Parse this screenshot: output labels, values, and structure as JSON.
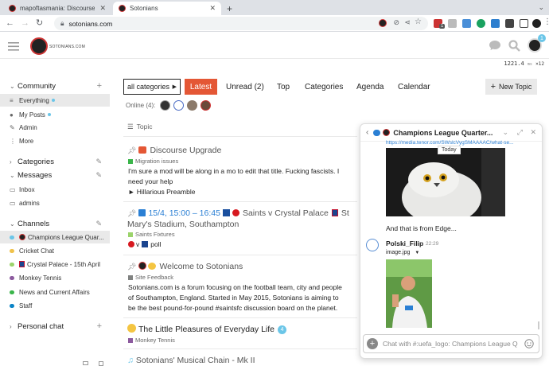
{
  "browser": {
    "tabs": [
      {
        "title": "mapoftasmania: Discourse Upgrade",
        "active": false
      },
      {
        "title": "Sotonians",
        "active": true
      }
    ],
    "new_tab": "+",
    "url": "sotonians.com",
    "ext_badge": "1"
  },
  "site": {
    "logo_text": "SOTONIANS.COM",
    "notif_count": "1",
    "counter": "1221.4",
    "counter_small": "ms",
    "counter_suffix": "×12"
  },
  "sidebar": {
    "community_label": "Community",
    "community_items": [
      {
        "label": "Everything",
        "icon": "layer-icon",
        "glyph": "≡",
        "dot": true,
        "selected": true
      },
      {
        "label": "My Posts",
        "icon": "user-icon",
        "glyph": "●",
        "dot": true,
        "selected": false
      },
      {
        "label": "Admin",
        "icon": "wrench-icon",
        "glyph": "✎",
        "dot": false,
        "selected": false
      },
      {
        "label": "More",
        "icon": "ellipsis-icon",
        "glyph": "⋮",
        "dot": false,
        "selected": false
      }
    ],
    "categories_label": "Categories",
    "messages_label": "Messages",
    "message_items": [
      {
        "label": "Inbox",
        "icon": "inbox-icon",
        "glyph": "▭"
      },
      {
        "label": "admins",
        "icon": "group-icon",
        "glyph": "▭"
      }
    ],
    "channels_label": "Channels",
    "channels": [
      {
        "label": "Champions League Quar...",
        "color": "#6bc6e8",
        "selected": true,
        "emoji": "uefa-logo-icon"
      },
      {
        "label": "Cricket Chat",
        "color": "#f0c24b",
        "selected": false,
        "emoji": ""
      },
      {
        "label": "Crystal Palace - 15th April",
        "color": "#9bd36b",
        "selected": false,
        "emoji": "palace-crest-icon"
      },
      {
        "label": "Monkey Tennis",
        "color": "#8c5a9e",
        "selected": false,
        "emoji": ""
      },
      {
        "label": "News and Current Affairs",
        "color": "#3ab54a",
        "selected": false,
        "emoji": ""
      },
      {
        "label": "Staff",
        "color": "#0b84c7",
        "selected": false,
        "emoji": "lock-icon"
      }
    ],
    "personal_label": "Personal chat"
  },
  "nav": {
    "category_select": "all categories",
    "tabs": [
      "Latest",
      "Unread (2)",
      "Top",
      "Categories",
      "Agenda",
      "Calendar"
    ],
    "new_topic": "New Topic",
    "online": "Online (4):",
    "topic_col": "Topic"
  },
  "topics": [
    {
      "title": "Discourse Upgrade",
      "category": "Migration issues",
      "cat_color": "#3ab54a",
      "excerpt_lines": [
        "I'm sure a mod will be along in a mo to edit that title. Fucking fascists. I",
        "need your help"
      ],
      "details": "► Hillarious Preamble"
    },
    {
      "title_date": "15/4, 15:00 – 16:45",
      "title_rest": "Saints v Crystal Palace",
      "title_line2": "Mary's Stadium, Southampton",
      "title_st": "St",
      "category": "Saints Fixtures",
      "cat_color": "#9bd36b",
      "poll_v": "v",
      "poll": "poll"
    },
    {
      "title": "Welcome to Sotonians",
      "category": "Site Feedback",
      "cat_color": "#808281",
      "excerpt_lines": [
        "Sotonians.com is a forum focusing on the football team, city and people",
        "of Southampton, England. Started in May 2015, Sotonians is aiming to",
        "be the best pound-for-pound #saintsfc discussion board on the planet."
      ]
    },
    {
      "title": "The Little Pleasures of Everyday Life",
      "badge": "4",
      "category": "Monkey Tennis",
      "cat_color": "#8c5a9e"
    },
    {
      "title": "Sotonians' Musical Chain - Mk II"
    }
  ],
  "chat": {
    "title": "Champions League Quarter...",
    "link_text": "https://media.tenor.com/SWslcVygSMAAAAC/what-se...",
    "today": "Today",
    "message_text": "And that is from Edge...",
    "user": "Polski_Filip",
    "time": "22:29",
    "attachment": "image.jpg",
    "input_placeholder": "Chat with #:uefa_logo: Champions League Qu"
  },
  "colors": {
    "accent": "#e45735",
    "online_blue": "#6bc6e8"
  }
}
